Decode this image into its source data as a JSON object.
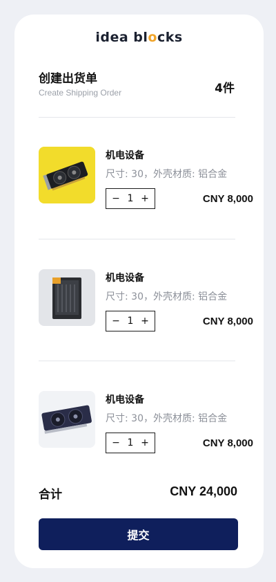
{
  "app": {
    "logo_pre": "idea bl",
    "logo_accent": "o",
    "logo_post": "cks"
  },
  "header": {
    "title": "创建出货单",
    "subtitle": "Create Shipping Order",
    "count": "4件"
  },
  "items": [
    {
      "name": "机电设备",
      "spec": "尺寸: 30，外壳材质: 铝合金",
      "minus": "−",
      "quantity": "1",
      "plus": "+",
      "price": "CNY 8,000",
      "thumb_icon": "graphics-card-icon"
    },
    {
      "name": "机电设备",
      "spec": "尺寸: 30，外壳材质: 铝合金",
      "minus": "−",
      "quantity": "1",
      "plus": "+",
      "price": "CNY 8,000",
      "thumb_icon": "pc-case-icon"
    },
    {
      "name": "机电设备",
      "spec": "尺寸: 30，外壳材质: 铝合金",
      "minus": "−",
      "quantity": "1",
      "plus": "+",
      "price": "CNY 8,000",
      "thumb_icon": "graphics-card-icon"
    }
  ],
  "summary": {
    "total_label": "合计",
    "total_value": "CNY 24,000"
  },
  "actions": {
    "submit_label": "提交"
  },
  "colors": {
    "accent": "#f0a42a",
    "primary_button": "#0f1f5c",
    "background": "#eef0f5"
  }
}
